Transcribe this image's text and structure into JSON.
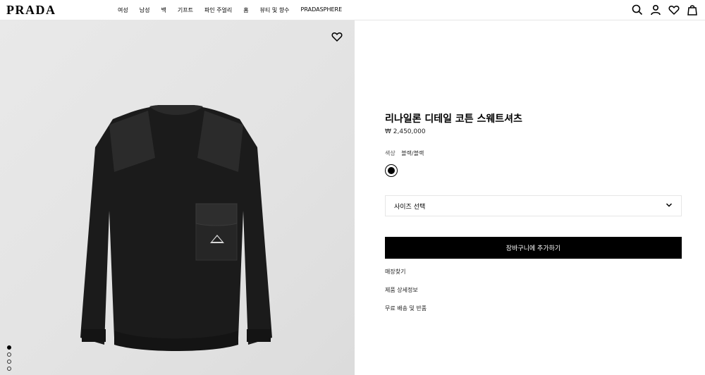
{
  "header": {
    "logo": "PRADA",
    "nav": [
      "여성",
      "남성",
      "백",
      "기프트",
      "파인 주얼리",
      "홈",
      "뷰티 및 향수",
      "PRADASPHERE"
    ],
    "icons": [
      "search-icon",
      "account-icon",
      "wishlist-icon",
      "bag-icon"
    ]
  },
  "gallery": {
    "wishlist_icon": "heart-icon",
    "dots_count": 4,
    "active_dot": 0
  },
  "product": {
    "title": "리나일론 디테일 코튼 스웨트셔츠",
    "price": "₩ 2,450,000",
    "color_label": "색상",
    "color_value": "블랙/블랙",
    "swatch_color": "#000000",
    "size_placeholder": "사이즈 선택",
    "add_to_cart": "장바구니에 추가하기",
    "links": [
      "매장찾기",
      "제품 상세정보",
      "무료 배송 및 반품"
    ]
  }
}
